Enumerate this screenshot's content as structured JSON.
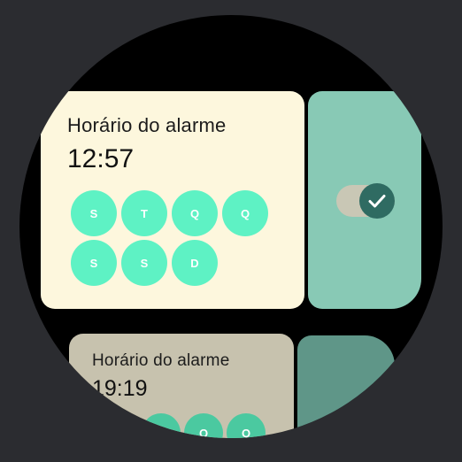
{
  "alarms": [
    {
      "title": "Horário do alarme",
      "time": "12:57",
      "days": [
        "S",
        "T",
        "Q",
        "Q",
        "S",
        "S",
        "D"
      ],
      "enabled": true
    },
    {
      "title": "Horário do alarme",
      "time": "19:19",
      "days": [
        "S",
        "Q",
        "Q"
      ],
      "enabled": false
    }
  ],
  "colors": {
    "card_active": "#fdf7dd",
    "card_dim": "#c7c2ae",
    "toggle_panel_active": "#88c9b5",
    "toggle_panel_dim": "#5f9688",
    "day_chip": "#5ef2c4",
    "knob": "#2f6b62"
  },
  "icons": {
    "toggle_knob": "check-icon"
  }
}
